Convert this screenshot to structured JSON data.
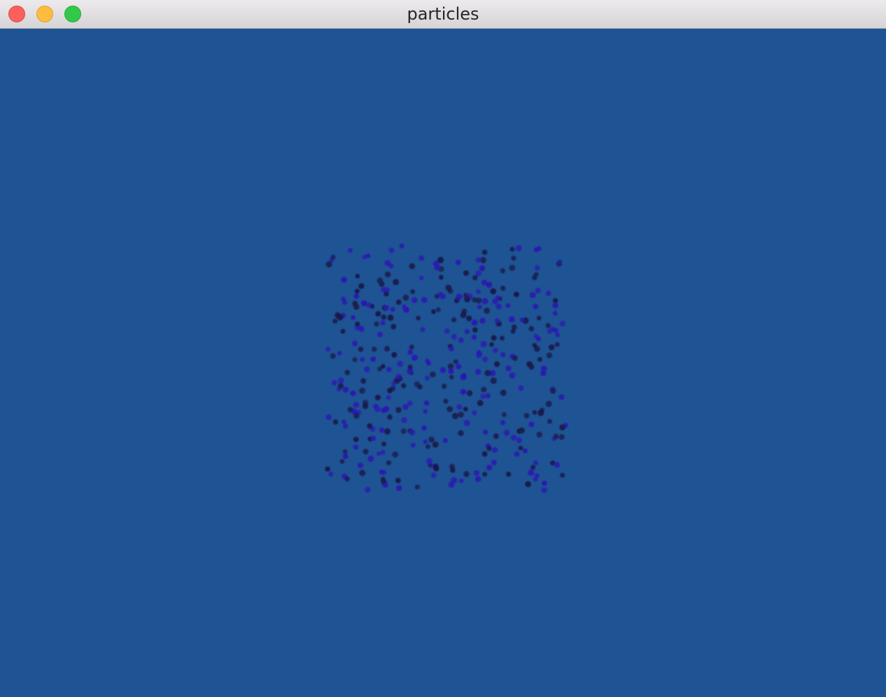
{
  "window": {
    "title": "particles",
    "controls": {
      "close_icon": "close-icon",
      "minimize_icon": "minimize-icon",
      "zoom_icon": "zoom-icon"
    }
  },
  "colors": {
    "background": "#1e5493",
    "particle_dark": "#1a1a4a",
    "particle_blue": "#2a1ab0"
  }
}
